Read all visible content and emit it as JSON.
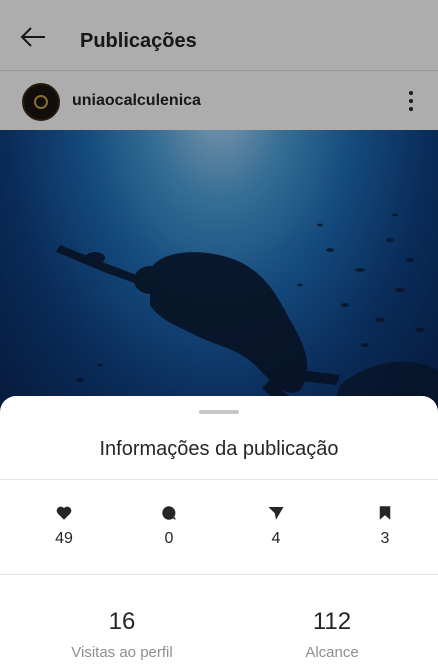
{
  "header": {
    "title": "Publicações",
    "back_icon": "arrow-left-icon"
  },
  "post": {
    "username": "uniaocalculenica",
    "more_icon": "more-vertical-icon",
    "image": "underwater diver photo"
  },
  "sheet": {
    "title": "Informações da publicação",
    "metrics": [
      {
        "icon": "heart-icon",
        "value": "49"
      },
      {
        "icon": "comment-icon",
        "value": "0"
      },
      {
        "icon": "send-icon",
        "value": "4"
      },
      {
        "icon": "bookmark-icon",
        "value": "3"
      }
    ],
    "stats": [
      {
        "value": "16",
        "label": "Visitas ao perfil"
      },
      {
        "value": "112",
        "label": "Alcance"
      }
    ]
  },
  "colors": {
    "text": "#262626",
    "muted": "#8e8e8e",
    "overlay": "rgba(0,0,0,0.32)"
  }
}
